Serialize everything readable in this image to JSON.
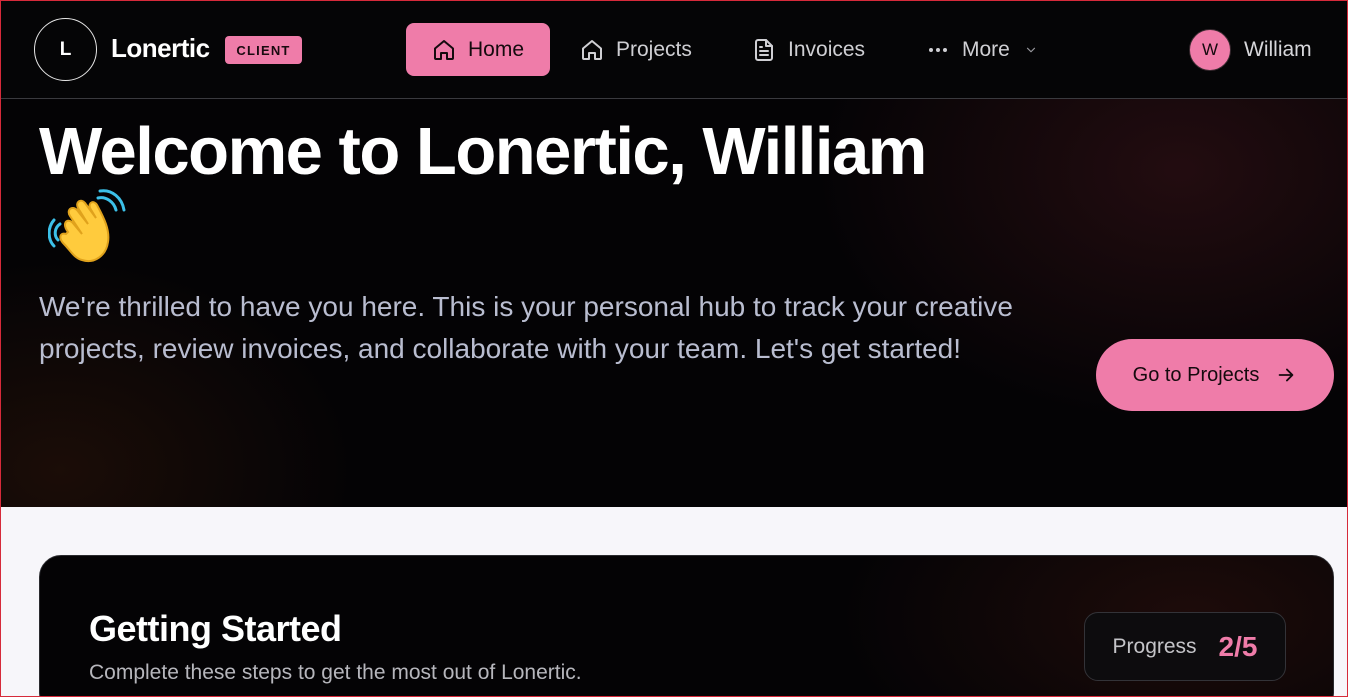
{
  "header": {
    "logo_letter": "L",
    "brand": "Lonertic",
    "badge": "CLIENT",
    "nav": [
      {
        "label": "Home",
        "icon": "home-icon"
      },
      {
        "label": "Projects",
        "icon": "home-icon"
      },
      {
        "label": "Invoices",
        "icon": "document-icon"
      },
      {
        "label": "More",
        "icon": "dots-icon"
      }
    ],
    "user": {
      "initial": "W",
      "name": "William"
    }
  },
  "hero": {
    "title": "Welcome to Lonertic, William",
    "emoji": "waving-hand",
    "subtitle": "We're thrilled to have you here. This is your personal hub to track your creative projects, review invoices, and collaborate with your team. Let's get started!",
    "cta_label": "Go to Projects"
  },
  "getting_started": {
    "title": "Getting Started",
    "subtitle": "Complete these steps to get the most out of Lonertic.",
    "progress_label": "Progress",
    "progress_value": "2/5",
    "progress_fraction": 0.4
  },
  "colors": {
    "accent": "#ef7ca9",
    "background_dark": "#040305",
    "page_background": "#f7f6fa"
  }
}
